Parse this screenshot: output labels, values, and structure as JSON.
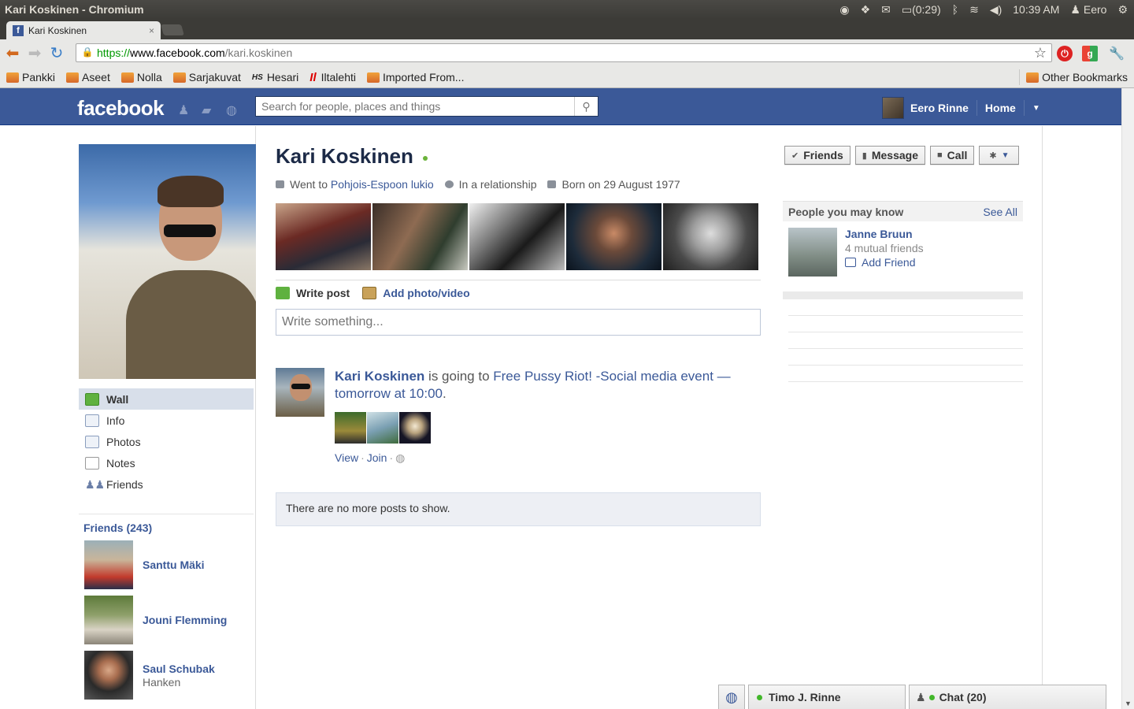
{
  "os": {
    "window_title": "Kari Koskinen - Chromium",
    "battery": "(0:29)",
    "clock": "10:39 AM",
    "user": "Eero"
  },
  "browser": {
    "tab_title": "Kari Koskinen",
    "url_scheme": "https://",
    "url_host": "www.facebook.com",
    "url_path": "/kari.koskinen",
    "bookmarks": [
      "Pankki",
      "Aseet",
      "Nolla",
      "Sarjakuvat",
      "Hesari",
      "Iltalehti",
      "Imported From..."
    ],
    "other_bookmarks": "Other Bookmarks"
  },
  "fb_header": {
    "logo": "facebook",
    "search_placeholder": "Search for people, places and things",
    "user_name": "Eero Rinne",
    "home": "Home"
  },
  "profile": {
    "name": "Kari Koskinen",
    "went_to_prefix": "Went to ",
    "school": "Pohjois-Espoon lukio",
    "relationship": "In a relationship",
    "born": "Born on 29 August 1977"
  },
  "left_nav": [
    "Wall",
    "Info",
    "Photos",
    "Notes",
    "Friends"
  ],
  "friends": {
    "header": "Friends (243)",
    "list": [
      {
        "name": "Santtu Mäki",
        "sub": ""
      },
      {
        "name": "Jouni Flemming",
        "sub": ""
      },
      {
        "name": "Saul Schubak",
        "sub": "Hanken"
      }
    ]
  },
  "composer": {
    "write_post": "Write post",
    "add_photo": "Add photo/video",
    "placeholder": "Write something..."
  },
  "story": {
    "actor": "Kari Koskinen",
    "verb": " is going to ",
    "event": "Free Pussy Riot! -Social media event — tomorrow at 10:00",
    "end": ".",
    "view": "View",
    "join": "Join"
  },
  "no_more_posts": "There are no more posts to show.",
  "actions": {
    "friends": "Friends",
    "message": "Message",
    "call": "Call"
  },
  "pymk": {
    "title": "People you may know",
    "see_all": "See All",
    "name": "Janne Bruun",
    "mutual": "4 mutual friends",
    "add": "Add Friend"
  },
  "chat": {
    "open_chat": "Timo J. Rinne",
    "chat_label": "Chat",
    "chat_count": "(20)"
  },
  "colors": {
    "fb_blue": "#3b5998",
    "link": "#3b5998",
    "online": "#42b72a"
  }
}
